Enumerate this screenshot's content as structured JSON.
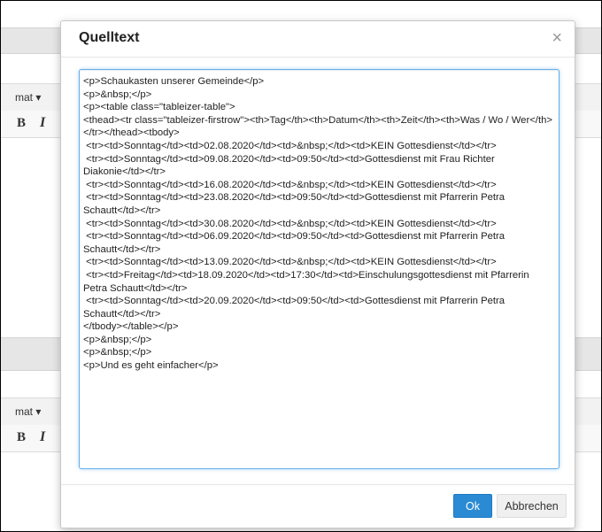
{
  "background_editor": {
    "format_label_1": "mat ▾",
    "bold_label_1": "B",
    "italic_label_1": "I",
    "format_label_2": "mat ▾",
    "bold_label_2": "B",
    "italic_label_2": "I"
  },
  "dialog": {
    "title": "Quelltext",
    "close_icon": "×",
    "source_code": "<p>Schaukasten unserer Gemeinde</p>\n<p>&nbsp;</p>\n<p><table class=\"tableizer-table\">\n<thead><tr class=\"tableizer-firstrow\"><th>Tag</th><th>Datum</th><th>Zeit</th><th>Was / Wo / Wer</th></tr></thead><tbody>\n <tr><td>Sonntag</td><td>02.08.2020</td><td>&nbsp;</td><td>KEIN Gottesdienst</td></tr>\n <tr><td>Sonntag</td><td>09.08.2020</td><td>09:50</td><td>Gottesdienst mit Frau Richter Diakonie</td></tr>\n <tr><td>Sonntag</td><td>16.08.2020</td><td>&nbsp;</td><td>KEIN Gottesdienst</td></tr>\n <tr><td>Sonntag</td><td>23.08.2020</td><td>09:50</td><td>Gottesdienst mit Pfarrerin Petra Schautt</td></tr>\n <tr><td>Sonntag</td><td>30.08.2020</td><td>&nbsp;</td><td>KEIN Gottesdienst</td></tr>\n <tr><td>Sonntag</td><td>06.09.2020</td><td>09:50</td><td>Gottesdienst mit Pfarrerin Petra Schautt</td></tr>\n <tr><td>Sonntag</td><td>13.09.2020</td><td>&nbsp;</td><td>KEIN Gottesdienst</td></tr>\n <tr><td>Freitag</td><td>18.09.2020</td><td>17:30</td><td>Einschulungsgottesdienst mit Pfarrerin Petra Schautt</td></tr>\n <tr><td>Sonntag</td><td>20.09.2020</td><td>09:50</td><td>Gottesdienst mit Pfarrerin Petra Schautt</td></tr>\n</tbody></table></p>\n<p>&nbsp;</p>\n<p>&nbsp;</p>\n<p>Und es geht einfacher</p>",
    "ok_label": "Ok",
    "cancel_label": "Abbrechen"
  },
  "colors": {
    "primary_button": "#2a8ad4",
    "focus_border": "#66afe9"
  }
}
